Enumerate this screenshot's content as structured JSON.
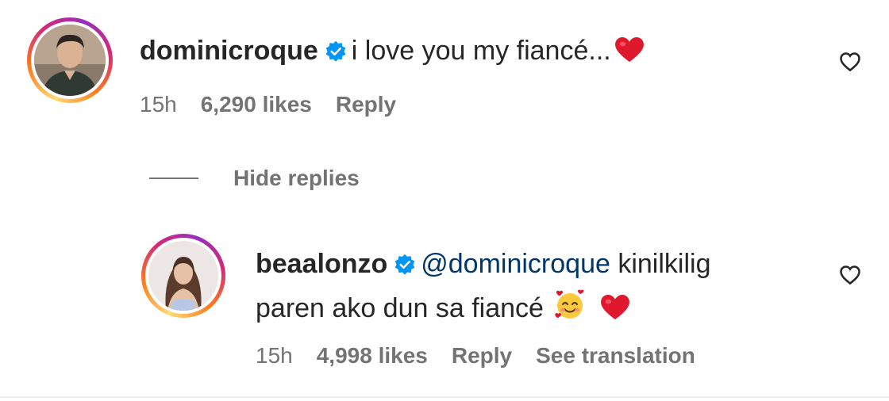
{
  "comment": {
    "username": "dominicroque",
    "verified": true,
    "text": "i love you my fiancé...",
    "emoji": "red-heart",
    "time": "15h",
    "likes": "6,290 likes",
    "reply_label": "Reply",
    "avatar_icon": "profile-photo-man"
  },
  "toggle": {
    "hide_replies_label": "Hide replies"
  },
  "reply": {
    "username": "beaalonzo",
    "verified": true,
    "mention": "@dominicroque",
    "text_line1": "kinilkilig",
    "text_line2": "paren ako dun sa fiancé",
    "emojis": [
      "smiling-face-with-hearts",
      "red-heart"
    ],
    "time": "15h",
    "likes": "4,998 likes",
    "reply_label": "Reply",
    "translation_label": "See translation",
    "avatar_icon": "profile-photo-woman"
  },
  "colors": {
    "text": "#262626",
    "secondary": "#737373",
    "mention": "#00376b",
    "verified": "#0095f6",
    "heart": "#ed4956"
  }
}
